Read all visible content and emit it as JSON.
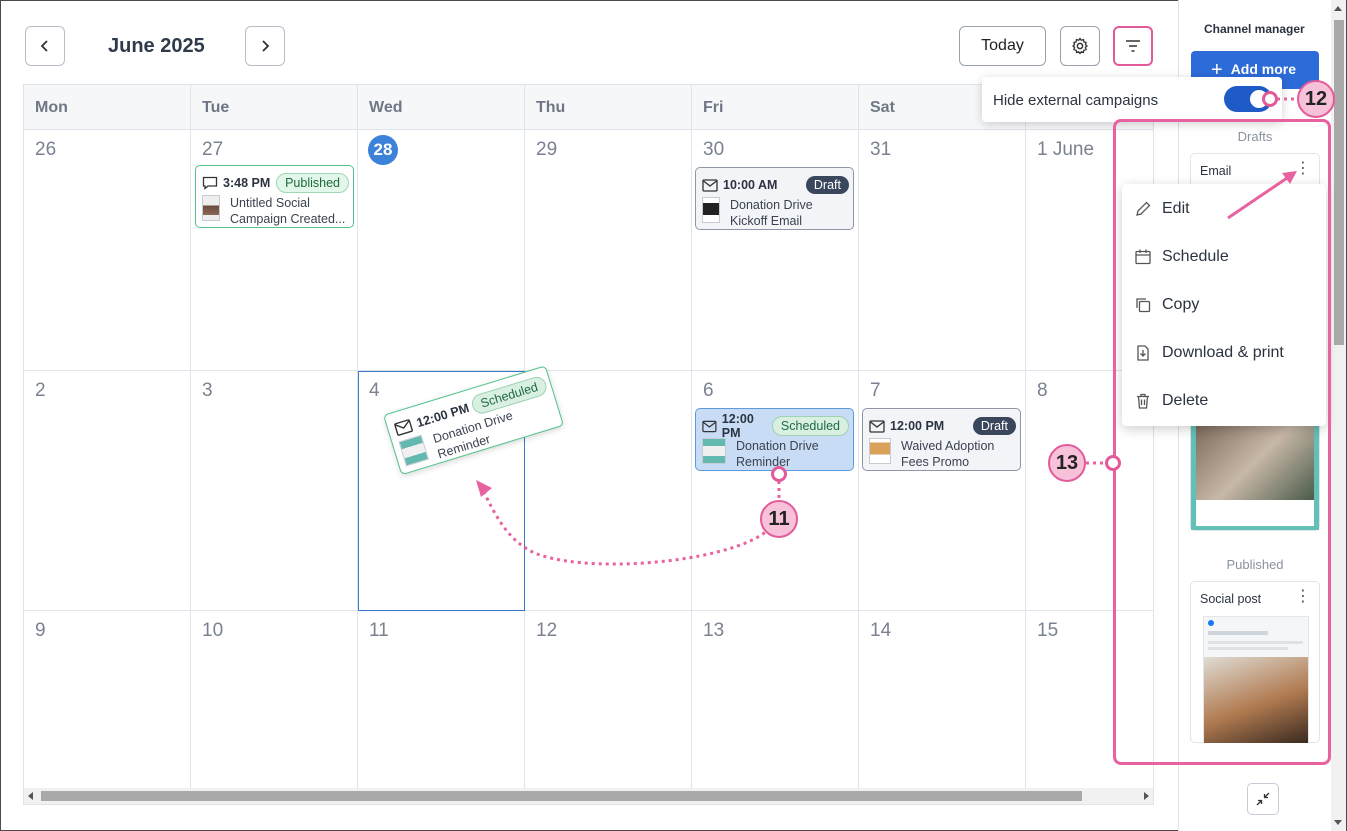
{
  "header": {
    "month_label": "June 2025",
    "today_label": "Today"
  },
  "calendar": {
    "days_of_week": [
      "Mon",
      "Tue",
      "Wed",
      "Thu",
      "Fri",
      "Sat",
      "Sun"
    ],
    "weeks": [
      [
        "26",
        "27",
        "28",
        "29",
        "30",
        "31",
        "1 June"
      ],
      [
        "2",
        "3",
        "4",
        "5",
        "6",
        "7",
        "8"
      ],
      [
        "9",
        "10",
        "11",
        "12",
        "13",
        "14",
        "15"
      ]
    ],
    "today_day": "28",
    "events": {
      "tue27": {
        "time": "3:48 PM",
        "status": "Published",
        "title1": "Untitled Social",
        "title2": "Campaign Created..."
      },
      "fri30": {
        "time": "10:00 AM",
        "status": "Draft",
        "title1": "Donation Drive",
        "title2": "Kickoff Email"
      },
      "fri6": {
        "time": "12:00 PM",
        "status": "Scheduled",
        "title1": "Donation Drive",
        "title2": "Reminder"
      },
      "sat7": {
        "time": "12:00 PM",
        "status": "Draft",
        "title1": "Waived Adoption",
        "title2": "Fees Promo"
      },
      "dragged": {
        "time": "12:00 PM",
        "status": "Scheduled",
        "title1": "Donation Drive",
        "title2": "Reminder"
      }
    }
  },
  "toggle_popover": {
    "label": "Hide external campaigns",
    "enabled": true
  },
  "channel_manager": {
    "title": "Channel manager",
    "add_more_label": "Add more",
    "drafts_label": "Drafts",
    "published_label": "Published",
    "draft_card_title": "Email",
    "published_card_title": "Social post"
  },
  "context_menu": {
    "items": [
      "Edit",
      "Schedule",
      "Copy",
      "Download & print",
      "Delete"
    ]
  },
  "callouts": {
    "c11": "11",
    "c12": "12",
    "c13": "13"
  },
  "colors": {
    "accent": "#e35a9a",
    "primary": "#2d6bd8",
    "today": "#3b82d8"
  }
}
